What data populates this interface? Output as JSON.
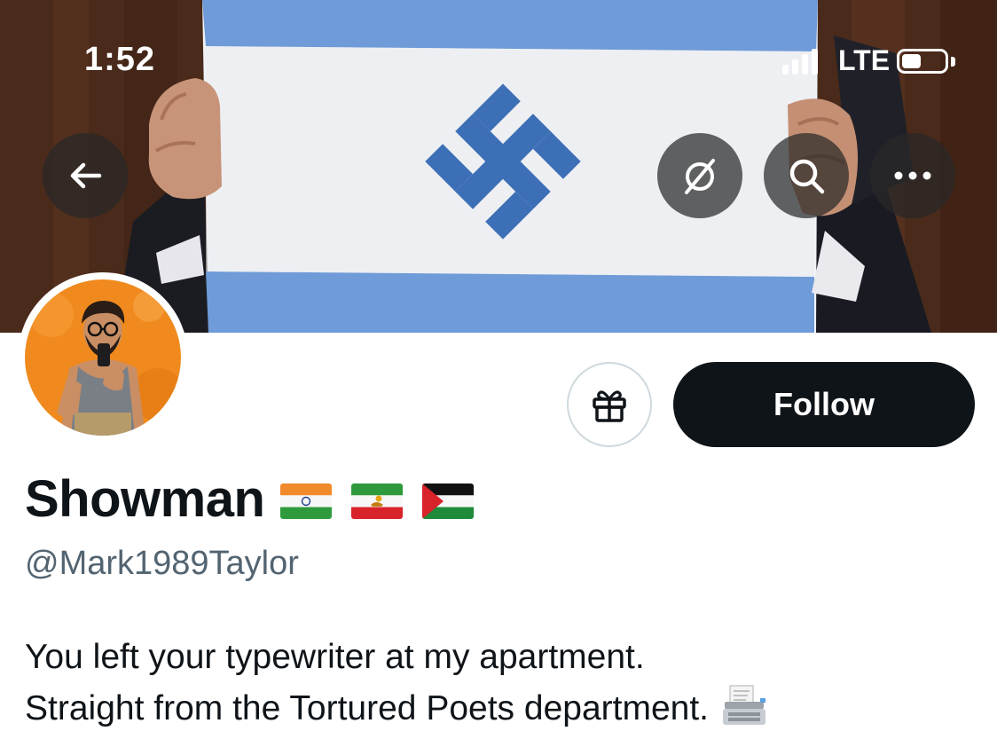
{
  "status_bar": {
    "time": "1:52",
    "network": "LTE",
    "battery_level": 0.45
  },
  "banner": {
    "description_icon": "flag-banner-image"
  },
  "nav": {
    "back_icon": "arrow-left-icon",
    "grok_icon": "grok-icon",
    "search_icon": "search-icon",
    "more_icon": "more-icon"
  },
  "profile": {
    "display_name": "Showman",
    "handle": "@Mark1989Taylor",
    "flag_icons": [
      "india-flag-icon",
      "iran-lion-sun-flag-icon",
      "palestine-flag-icon"
    ],
    "bio_line1": "You left your typewriter at my apartment.",
    "bio_line2": "Straight from the Tortured Poets department.",
    "bio_emoji_icon": "typewriter-emoji-icon"
  },
  "actions": {
    "gift_icon": "gift-icon",
    "follow_label": "Follow"
  },
  "colors": {
    "follow_bg": "#0f1419",
    "handle_text": "#536471",
    "flag_blue": "#6f9bd8",
    "symbol_blue": "#3d6fb6"
  }
}
